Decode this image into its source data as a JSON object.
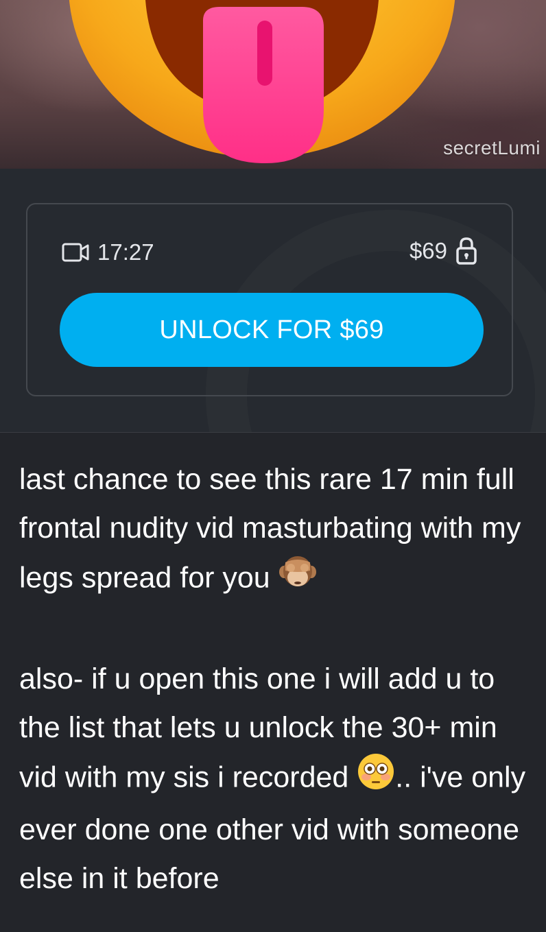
{
  "preview": {
    "creator_watermark": "secretLumi",
    "sticker_icon": "tongue-out-emoji-icon"
  },
  "locked_media": {
    "duration": "17:27",
    "price": "$69",
    "video_icon": "video-camera-icon",
    "lock_icon": "lock-icon",
    "unlock_label": "UNLOCK FOR $69",
    "accent_color": "#00aff0"
  },
  "message": {
    "paragraph1": "last chance to see this rare 17 min full frontal nudity vid masturbating with my legs spread for you",
    "paragraph1_emoji": "see-no-evil-monkey-icon",
    "paragraph2_part1": "also- if u open this one i will add u to the list that lets u unlock the 30+ min vid with my sis i recorded",
    "paragraph2_emoji": "flushed-face-icon",
    "paragraph2_part2": ".. i've only ever done one other vid with someone else in it before"
  }
}
